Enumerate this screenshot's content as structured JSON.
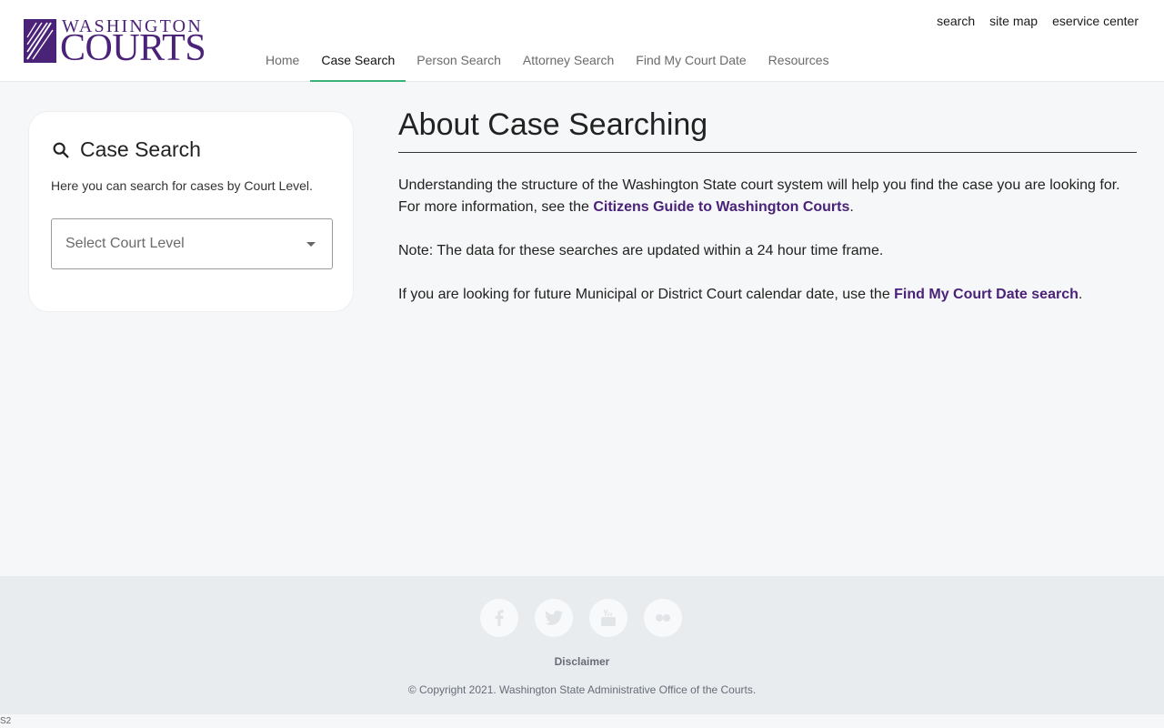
{
  "header": {
    "logo_top": "WASHINGTON",
    "logo_bottom": "COURTS",
    "utility_links": [
      "search",
      "site map",
      "eservice center"
    ],
    "nav_tabs": [
      "Home",
      "Case Search",
      "Person Search",
      "Attorney Search",
      "Find My Court Date",
      "Resources"
    ],
    "active_tab": "Case Search"
  },
  "sidebar": {
    "title": "Case Search",
    "description": "Here you can search for cases by Court Level.",
    "select_placeholder": "Select Court Level"
  },
  "main": {
    "heading": "About Case Searching",
    "p1_text": "Understanding the structure of the Washington State court system will help you find the case you are looking for. For more information, see the ",
    "p1_link": "Citizens Guide to Washington Courts",
    "p1_end": ".",
    "p2_text": "Note: The data for these searches are updated within a 24 hour time frame.",
    "p3_text": "If you are looking for future Municipal or District Court calendar date, use the ",
    "p3_link": "Find My Court Date search",
    "p3_end": "."
  },
  "footer": {
    "social": [
      "facebook-icon",
      "twitter-icon",
      "youtube-icon",
      "flickr-icon"
    ],
    "disclaimer": "Disclaimer",
    "copyright": "© Copyright 2021. Washington State Administrative Office of the Courts."
  },
  "version_label": "S2",
  "colors": {
    "brand_purple": "#4a2278",
    "active_tab_underline": "#3ab27a"
  }
}
